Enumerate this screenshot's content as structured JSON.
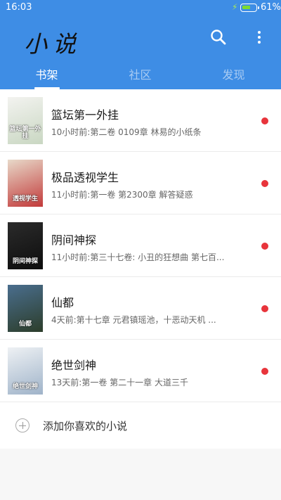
{
  "status_bar": {
    "time": "16:03",
    "battery": "61%",
    "battery_level": 0.61
  },
  "app": {
    "title": "小说"
  },
  "toolbar": {
    "search_icon": "search-icon",
    "more_icon": "more-vertical-icon"
  },
  "tabs": [
    {
      "label": "书架",
      "active": true
    },
    {
      "label": "社区",
      "active": false
    },
    {
      "label": "发现",
      "active": false
    }
  ],
  "books": [
    {
      "title": "篮坛第一外挂",
      "update": "10小时前:第二卷 0109章 林易的小纸条",
      "cover_text": "篮坛第一外挂",
      "cover_colors": [
        "#f3f3f0",
        "#c9d7c2"
      ],
      "unread": true
    },
    {
      "title": "极品透视学生",
      "update": "11小时前:第一卷 第2300章 解答疑惑",
      "cover_text": "透视学生",
      "cover_colors": [
        "#e8d9c9",
        "#c23a3a"
      ],
      "unread": true
    },
    {
      "title": "阴间神探",
      "update": "11小时前:第三十七卷: 小丑的狂想曲 第七百...",
      "cover_text": "阴间神探",
      "cover_colors": [
        "#2b2b2b",
        "#0d0d0d"
      ],
      "unread": true
    },
    {
      "title": "仙都",
      "update": "4天前:第十七章 元君镇瑶池，十恶动天机 ...",
      "cover_text": "仙都",
      "cover_colors": [
        "#4a6e8e",
        "#2c3d2a"
      ],
      "unread": true
    },
    {
      "title": "绝世剑神",
      "update": "13天前:第一卷 第二十一章 大道三千",
      "cover_text": "绝世剑神",
      "cover_colors": [
        "#eef1f4",
        "#9fb3c9"
      ],
      "unread": true
    }
  ],
  "add_row": {
    "label": "添加你喜欢的小说",
    "icon": "plus-circle-icon"
  },
  "colors": {
    "accent": "#3e8de5",
    "unread_dot": "#e8343b"
  }
}
